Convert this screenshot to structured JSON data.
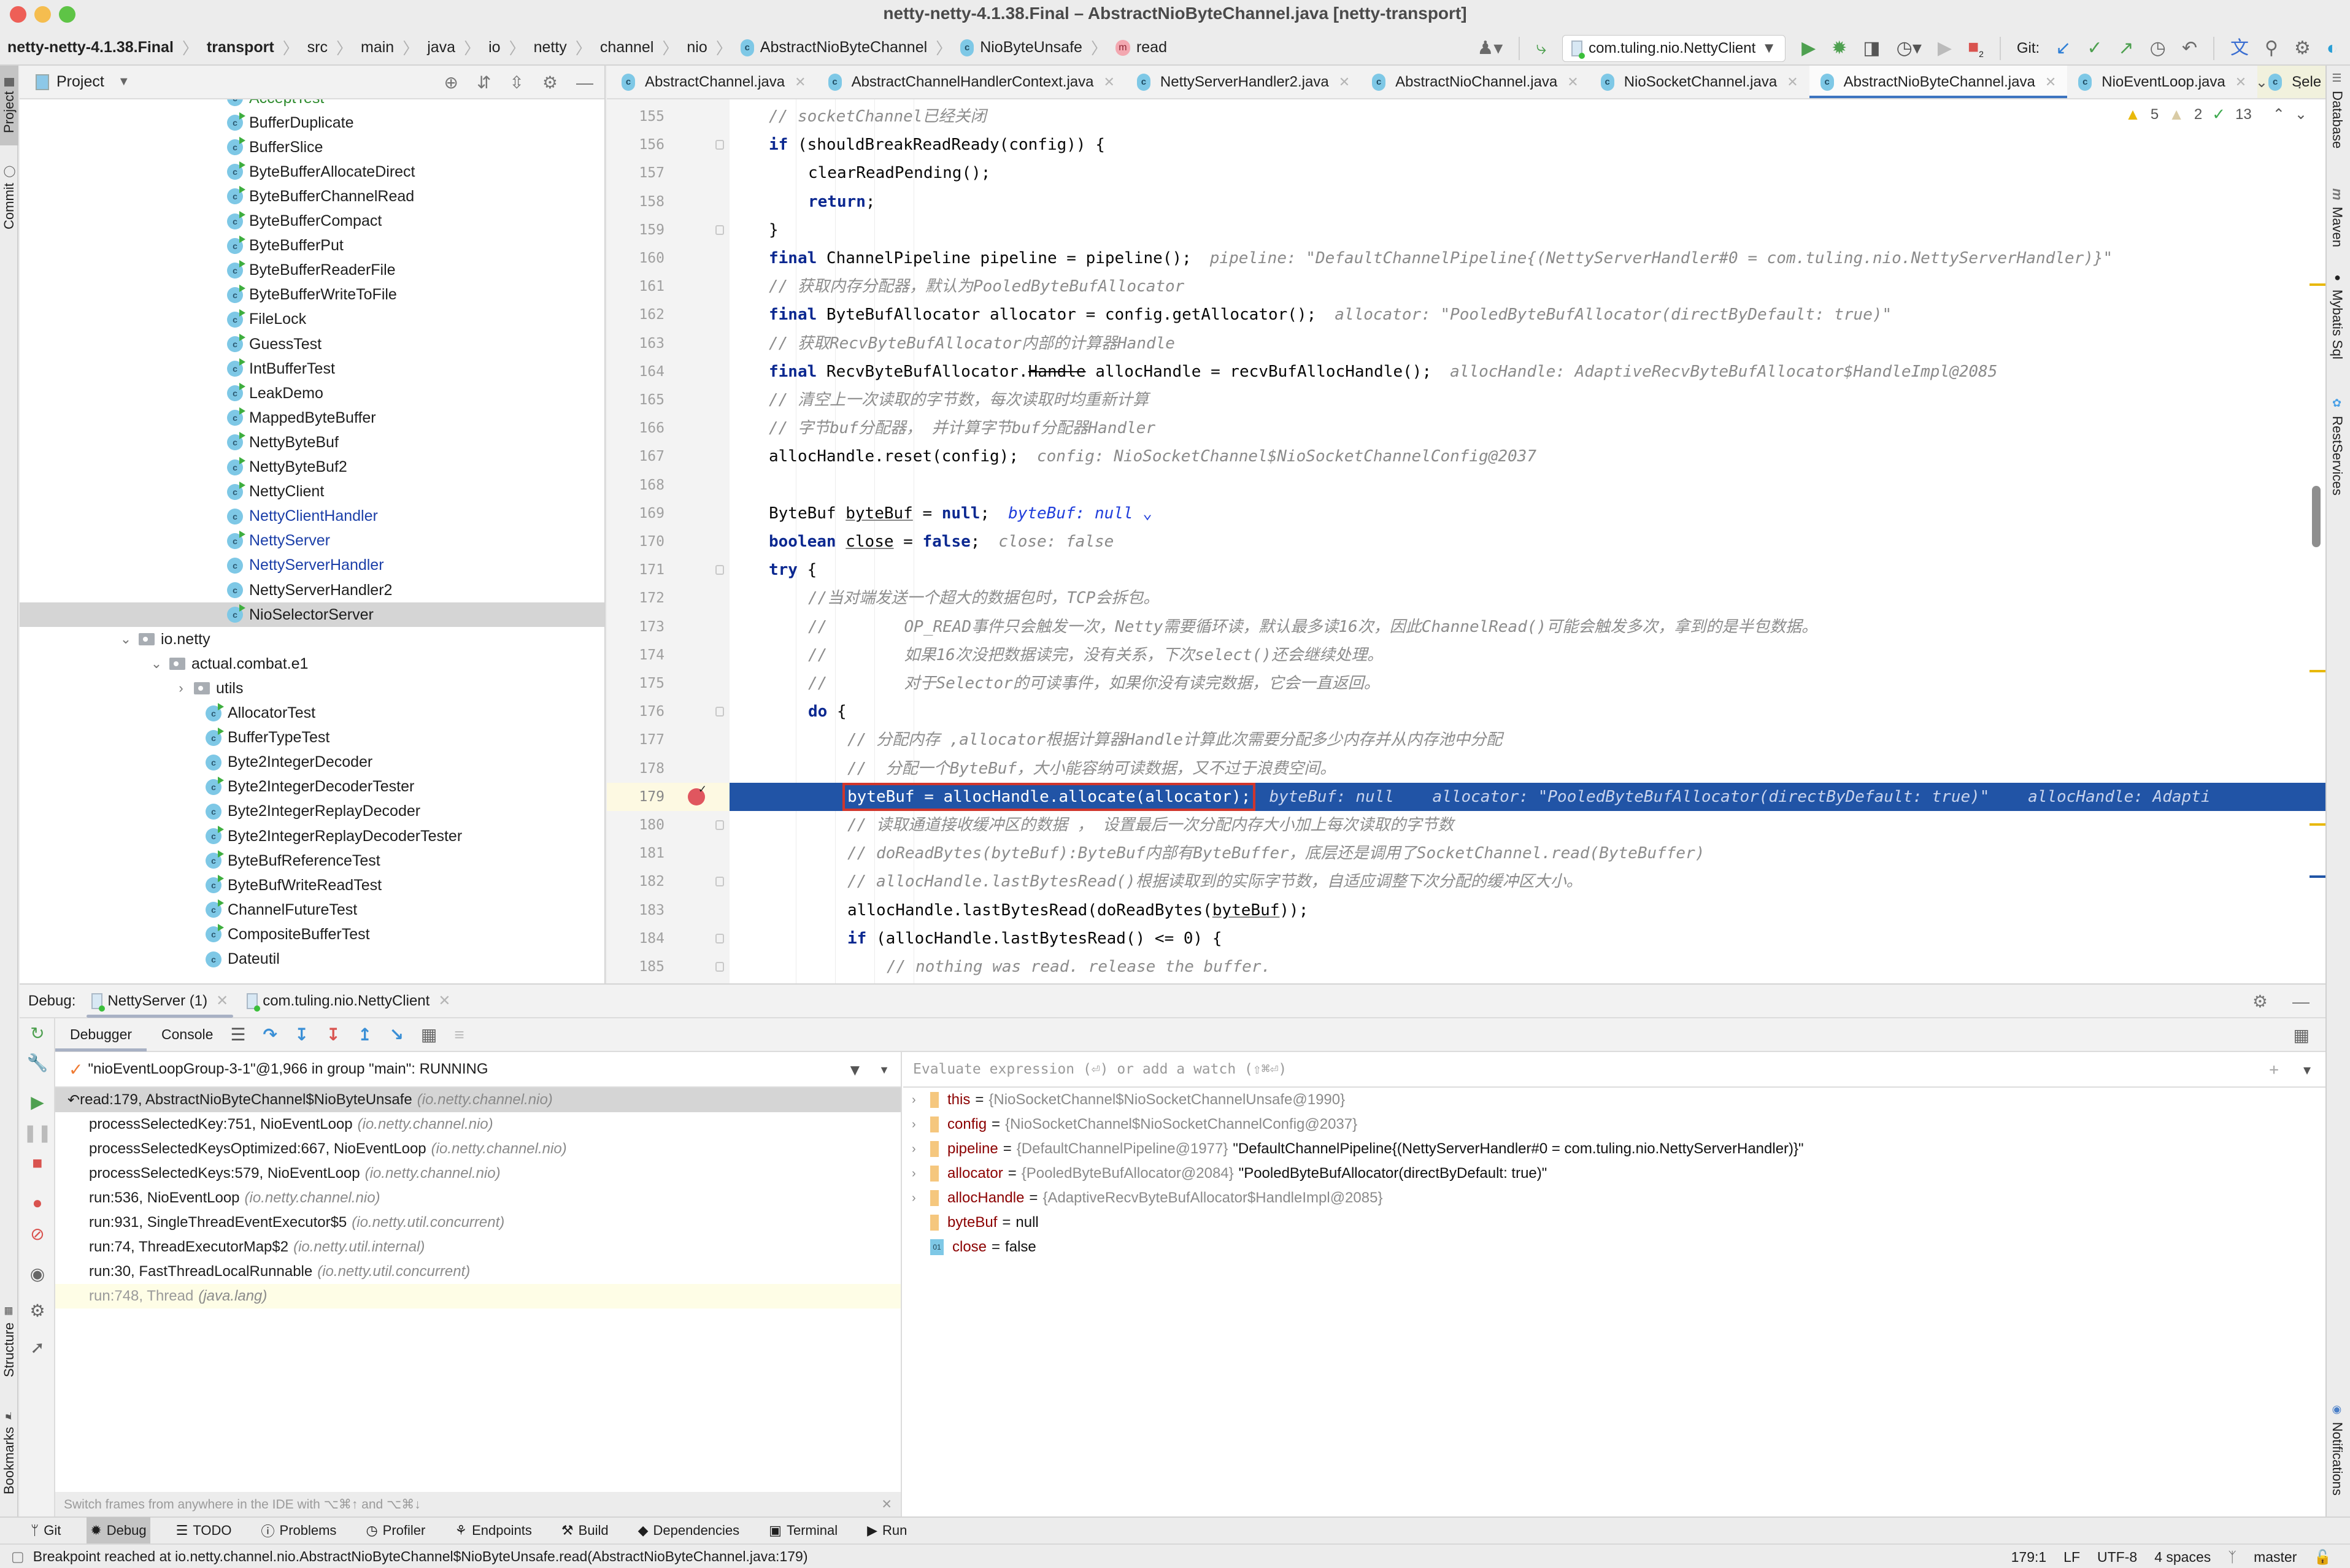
{
  "window": {
    "title": "netty-netty-4.1.38.Final – AbstractNioByteChannel.java [netty-transport]"
  },
  "breadcrumb": [
    {
      "label": "netty-netty-4.1.38.Final",
      "bold": true
    },
    {
      "label": "transport",
      "bold": true
    },
    {
      "label": "src"
    },
    {
      "label": "main"
    },
    {
      "label": "java"
    },
    {
      "label": "io"
    },
    {
      "label": "netty"
    },
    {
      "label": "channel"
    },
    {
      "label": "nio"
    },
    {
      "label": "AbstractNioByteChannel",
      "icon": "class-icon"
    },
    {
      "label": "NioByteUnsafe",
      "icon": "class-icon"
    },
    {
      "label": "read",
      "icon": "method-icon"
    }
  ],
  "toolbar": {
    "run_config": "com.tuling.nio.NettyClient",
    "git_label": "Git:",
    "stop_badge": "2"
  },
  "left_strip": {
    "project": "Project",
    "commit": "Commit",
    "structure": "Structure",
    "bookmarks": "Bookmarks"
  },
  "right_strip": {
    "database": "Database",
    "maven": "Maven",
    "mybatis": "Mybatis Sql",
    "rest": "RestServices",
    "notifications": "Notifications"
  },
  "project": {
    "title": "Project",
    "tree": [
      {
        "label": "AcceptTest",
        "type": "class",
        "run": true,
        "style": "green",
        "level": 2
      },
      {
        "label": "BufferDuplicate",
        "type": "class",
        "run": true,
        "level": 2
      },
      {
        "label": "BufferSlice",
        "type": "class",
        "run": true,
        "level": 2
      },
      {
        "label": "ByteBufferAllocateDirect",
        "type": "class",
        "run": true,
        "level": 2
      },
      {
        "label": "ByteBufferChannelRead",
        "type": "class",
        "run": true,
        "level": 2
      },
      {
        "label": "ByteBufferCompact",
        "type": "class",
        "run": true,
        "level": 2
      },
      {
        "label": "ByteBufferPut",
        "type": "class",
        "run": true,
        "level": 2
      },
      {
        "label": "ByteBufferReaderFile",
        "type": "class",
        "run": true,
        "level": 2
      },
      {
        "label": "ByteBufferWriteToFile",
        "type": "class",
        "run": true,
        "level": 2
      },
      {
        "label": "FileLock",
        "type": "class",
        "run": true,
        "level": 2
      },
      {
        "label": "GuessTest",
        "type": "class",
        "run": true,
        "level": 2
      },
      {
        "label": "IntBufferTest",
        "type": "class",
        "run": true,
        "level": 2
      },
      {
        "label": "LeakDemo",
        "type": "class",
        "run": true,
        "level": 2
      },
      {
        "label": "MappedByteBuffer",
        "type": "class",
        "run": true,
        "level": 2
      },
      {
        "label": "NettyByteBuf",
        "type": "class",
        "run": true,
        "level": 2
      },
      {
        "label": "NettyByteBuf2",
        "type": "class",
        "run": true,
        "level": 2
      },
      {
        "label": "NettyClient",
        "type": "class",
        "run": true,
        "level": 2
      },
      {
        "label": "NettyClientHandler",
        "type": "class",
        "run": false,
        "style": "blue",
        "level": 2
      },
      {
        "label": "NettyServer",
        "type": "class",
        "run": true,
        "style": "blue",
        "level": 2
      },
      {
        "label": "NettyServerHandler",
        "type": "class",
        "run": false,
        "style": "blue",
        "level": 2
      },
      {
        "label": "NettyServerHandler2",
        "type": "class",
        "run": false,
        "level": 2
      },
      {
        "label": "NioSelectorServer",
        "type": "class",
        "run": true,
        "level": 2,
        "selected": true
      },
      {
        "label": "io.netty",
        "type": "package",
        "expanded": true,
        "level": 0
      },
      {
        "label": "actual.combat.e1",
        "type": "package",
        "expanded": true,
        "level": 1
      },
      {
        "label": "utils",
        "type": "package",
        "expanded": false,
        "level": 2
      },
      {
        "label": "AllocatorTest",
        "type": "class",
        "run": true,
        "level": 3
      },
      {
        "label": "BufferTypeTest",
        "type": "class",
        "run": true,
        "level": 3
      },
      {
        "label": "Byte2IntegerDecoder",
        "type": "class",
        "run": false,
        "level": 3
      },
      {
        "label": "Byte2IntegerDecoderTester",
        "type": "class",
        "run": true,
        "level": 3
      },
      {
        "label": "Byte2IntegerReplayDecoder",
        "type": "class",
        "run": false,
        "level": 3
      },
      {
        "label": "Byte2IntegerReplayDecoderTester",
        "type": "class",
        "run": true,
        "level": 3
      },
      {
        "label": "ByteBufReferenceTest",
        "type": "class",
        "run": true,
        "level": 3
      },
      {
        "label": "ByteBufWriteReadTest",
        "type": "class",
        "run": true,
        "level": 3
      },
      {
        "label": "ChannelFutureTest",
        "type": "class",
        "run": true,
        "level": 3
      },
      {
        "label": "CompositeBufferTest",
        "type": "class",
        "run": true,
        "level": 3
      },
      {
        "label": "Dateutil",
        "type": "class",
        "run": false,
        "level": 3
      }
    ]
  },
  "editor": {
    "tabs": [
      {
        "label": "AbstractChannel.java"
      },
      {
        "label": "AbstractChannelHandlerContext.java"
      },
      {
        "label": "NettyServerHandler2.java"
      },
      {
        "label": "AbstractNioChannel.java"
      },
      {
        "label": "NioSocketChannel.java"
      },
      {
        "label": "AbstractNioByteChannel.java",
        "active": true
      },
      {
        "label": "NioEventLoop.java"
      },
      {
        "label": "Sele",
        "pinned": true
      }
    ],
    "inspections": {
      "warnings": "5",
      "weak_warnings": "2",
      "typos": "13"
    },
    "current_line": 179,
    "lines": [
      {
        "n": 155,
        "indent": 2,
        "segs": [
          {
            "t": "// socketChannel已经关闭",
            "c": "cm"
          }
        ]
      },
      {
        "n": 156,
        "indent": 2,
        "fold": true,
        "segs": [
          {
            "t": "if",
            "c": "kw"
          },
          {
            "t": " (shouldBreakReadReady(config)) {"
          }
        ]
      },
      {
        "n": 157,
        "indent": 3,
        "segs": [
          {
            "t": "clearReadPending();"
          }
        ]
      },
      {
        "n": 158,
        "indent": 3,
        "segs": [
          {
            "t": "return",
            "c": "kw"
          },
          {
            "t": ";"
          }
        ]
      },
      {
        "n": 159,
        "indent": 2,
        "fold": true,
        "segs": [
          {
            "t": "}"
          }
        ]
      },
      {
        "n": 160,
        "indent": 2,
        "segs": [
          {
            "t": "final",
            "c": "kw"
          },
          {
            "t": " ChannelPipeline pipeline = pipeline();"
          },
          {
            "t": "pipeline: \"DefaultChannelPipeline{(NettyServerHandler#0 = com.tuling.nio.NettyServerHandler)}\"",
            "c": "hint"
          }
        ]
      },
      {
        "n": 161,
        "indent": 2,
        "segs": [
          {
            "t": "// 获取内存分配器，默认为PooledByteBufAllocator",
            "c": "cm"
          }
        ]
      },
      {
        "n": 162,
        "indent": 2,
        "segs": [
          {
            "t": "final",
            "c": "kw"
          },
          {
            "t": " ByteBufAllocator allocator = config.getAllocator();"
          },
          {
            "t": "allocator: \"PooledByteBufAllocator(directByDefault: true)\"",
            "c": "hint"
          }
        ]
      },
      {
        "n": 163,
        "indent": 2,
        "segs": [
          {
            "t": "// 获取RecvByteBufAllocator内部的计算器Handle",
            "c": "cm"
          }
        ]
      },
      {
        "n": 164,
        "indent": 2,
        "segs": [
          {
            "t": "final",
            "c": "kw"
          },
          {
            "t": " RecvByteBufAllocator."
          },
          {
            "t": "Handle",
            "c": "strike"
          },
          {
            "t": " allocHandle = recvBufAllocHandle();"
          },
          {
            "t": "allocHandle: AdaptiveRecvByteBufAllocator$HandleImpl@2085",
            "c": "hint"
          }
        ]
      },
      {
        "n": 165,
        "indent": 2,
        "segs": [
          {
            "t": "// 清空上一次读取的字节数，每次读取时均重新计算",
            "c": "cm"
          }
        ]
      },
      {
        "n": 166,
        "indent": 2,
        "segs": [
          {
            "t": "// 字节buf分配器， 并计算字节buf分配器Handler",
            "c": "cm"
          }
        ]
      },
      {
        "n": 167,
        "indent": 2,
        "segs": [
          {
            "t": "allocHandle.reset(config);"
          },
          {
            "t": "config: NioSocketChannel$NioSocketChannelConfig@2037",
            "c": "hint"
          }
        ]
      },
      {
        "n": 168,
        "indent": 2,
        "segs": []
      },
      {
        "n": 169,
        "indent": 2,
        "segs": [
          {
            "t": "ByteBuf "
          },
          {
            "t": "byteBuf",
            "c": "uline"
          },
          {
            "t": " = "
          },
          {
            "t": "null",
            "c": "kw"
          },
          {
            "t": ";"
          },
          {
            "t": "byteBuf: null ⌄",
            "c": "hint-blue"
          }
        ]
      },
      {
        "n": 170,
        "indent": 2,
        "segs": [
          {
            "t": "boolean",
            "c": "kw"
          },
          {
            "t": " "
          },
          {
            "t": "close",
            "c": "uline"
          },
          {
            "t": " = "
          },
          {
            "t": "false",
            "c": "kw"
          },
          {
            "t": ";"
          },
          {
            "t": "close: false",
            "c": "hint"
          }
        ]
      },
      {
        "n": 171,
        "indent": 2,
        "fold": true,
        "segs": [
          {
            "t": "try",
            "c": "kw"
          },
          {
            "t": " {"
          }
        ]
      },
      {
        "n": 172,
        "indent": 3,
        "segs": [
          {
            "t": "//当对端发送一个超大的数据包时，TCP会拆包。",
            "c": "cm"
          }
        ]
      },
      {
        "n": 173,
        "indent": 3,
        "segs": [
          {
            "t": "//        OP_READ事件只会触发一次，Netty需要循环读，默认最多读16次，因此ChannelRead()可能会触发多次，拿到的是半包数据。",
            "c": "cm"
          }
        ]
      },
      {
        "n": 174,
        "indent": 3,
        "segs": [
          {
            "t": "//        如果16次没把数据读完，没有关系，下次select()还会继续处理。",
            "c": "cm"
          }
        ]
      },
      {
        "n": 175,
        "indent": 3,
        "segs": [
          {
            "t": "//        对于Selector的可读事件，如果你没有读完数据，它会一直返回。",
            "c": "cm"
          }
        ]
      },
      {
        "n": 176,
        "indent": 3,
        "fold": true,
        "segs": [
          {
            "t": "do",
            "c": "kw"
          },
          {
            "t": " {"
          }
        ]
      },
      {
        "n": 177,
        "indent": 4,
        "segs": [
          {
            "t": "// 分配内存 ,allocator根据计算器Handle计算此次需要分配多少内存并从内存池中分配",
            "c": "cm"
          }
        ]
      },
      {
        "n": 178,
        "indent": 4,
        "segs": [
          {
            "t": "//  分配一个ByteBuf，大小能容纳可读数据，又不过于浪费空间。",
            "c": "cm"
          }
        ]
      },
      {
        "n": 179,
        "indent": 4,
        "highlight": true,
        "breakpoint": true,
        "segs": [
          {
            "t": "byteBuf = allocHandle.allocate(allocator);",
            "c": "redbox"
          },
          {
            "t": "byteBuf: null    allocator: \"PooledByteBufAllocator(directByDefault: true)\"    allocHandle: Adapti",
            "c": "hint"
          }
        ]
      },
      {
        "n": 180,
        "indent": 4,
        "fold": true,
        "segs": [
          {
            "t": "// 读取通道接收缓冲区的数据 ， 设置最后一次分配内存大小加上每次读取的字节数",
            "c": "cm"
          }
        ]
      },
      {
        "n": 181,
        "indent": 4,
        "segs": [
          {
            "t": "// doReadBytes(byteBuf):ByteBuf内部有ByteBuffer，底层还是调用了SocketChannel.read(ByteBuffer)",
            "c": "cm"
          }
        ]
      },
      {
        "n": 182,
        "indent": 4,
        "fold": true,
        "segs": [
          {
            "t": "// allocHandle.lastBytesRead()根据读取到的实际字节数，自适应调整下次分配的缓冲区大小。",
            "c": "cm"
          }
        ]
      },
      {
        "n": 183,
        "indent": 4,
        "segs": [
          {
            "t": "allocHandle.lastBytesRead(doReadBytes("
          },
          {
            "t": "byteBuf",
            "c": "uline"
          },
          {
            "t": "));"
          }
        ]
      },
      {
        "n": 184,
        "indent": 4,
        "fold": true,
        "segs": [
          {
            "t": "if",
            "c": "kw"
          },
          {
            "t": " (allocHandle.lastBytesRead() <= 0) {"
          }
        ]
      },
      {
        "n": 185,
        "indent": 5,
        "fold": true,
        "segs": [
          {
            "t": "// nothing was read. release the buffer.",
            "c": "cm"
          }
        ]
      }
    ]
  },
  "debug": {
    "label": "Debug:",
    "sessions": [
      {
        "label": "NettyServer (1)",
        "active": true
      },
      {
        "label": "com.tuling.nio.NettyClient"
      }
    ],
    "tabs": [
      {
        "label": "Debugger",
        "active": true
      },
      {
        "label": "Console"
      }
    ],
    "thread": "\"nioEventLoopGroup-3-1\"@1,966 in group \"main\": RUNNING",
    "frames": [
      {
        "method": "read:179, AbstractNioByteChannel$NioByteUnsafe",
        "pkg": "(io.netty.channel.nio)",
        "selected": true
      },
      {
        "method": "processSelectedKey:751, NioEventLoop",
        "pkg": "(io.netty.channel.nio)"
      },
      {
        "method": "processSelectedKeysOptimized:667, NioEventLoop",
        "pkg": "(io.netty.channel.nio)"
      },
      {
        "method": "processSelectedKeys:579, NioEventLoop",
        "pkg": "(io.netty.channel.nio)"
      },
      {
        "method": "run:536, NioEventLoop",
        "pkg": "(io.netty.channel.nio)"
      },
      {
        "method": "run:931, SingleThreadEventExecutor$5",
        "pkg": "(io.netty.util.concurrent)"
      },
      {
        "method": "run:74, ThreadExecutorMap$2",
        "pkg": "(io.netty.util.internal)"
      },
      {
        "method": "run:30, FastThreadLocalRunnable",
        "pkg": "(io.netty.util.concurrent)"
      },
      {
        "method": "run:748, Thread",
        "pkg": "(java.lang)",
        "library": true
      }
    ],
    "frames_hint": "Switch frames from anywhere in the IDE with ⌥⌘↑ and ⌥⌘↓",
    "watch_placeholder": "Evaluate expression (⏎) or add a watch (⇧⌘⏎)",
    "variables": [
      {
        "name": "this",
        "type": "{NioSocketChannel$NioSocketChannelUnsafe@1990}",
        "value": "",
        "expandable": true
      },
      {
        "name": "config",
        "type": "{NioSocketChannel$NioSocketChannelConfig@2037}",
        "value": "",
        "expandable": true
      },
      {
        "name": "pipeline",
        "type": "{DefaultChannelPipeline@1977}",
        "value": "\"DefaultChannelPipeline{(NettyServerHandler#0 = com.tuling.nio.NettyServerHandler)}\"",
        "expandable": true
      },
      {
        "name": "allocator",
        "type": "{PooledByteBufAllocator@2084}",
        "value": "\"PooledByteBufAllocator(directByDefault: true)\"",
        "expandable": true
      },
      {
        "name": "allocHandle",
        "type": "{AdaptiveRecvByteBufAllocator$HandleImpl@2085}",
        "value": "",
        "expandable": true
      },
      {
        "name": "byteBuf",
        "type": "",
        "value": "null",
        "expandable": false
      },
      {
        "name": "close",
        "type": "",
        "value": "false",
        "expandable": false,
        "primitive": true
      }
    ]
  },
  "bottom_tools": [
    {
      "label": "Git",
      "icon": "git-branch-icon"
    },
    {
      "label": "Debug",
      "icon": "bug-icon",
      "active": true
    },
    {
      "label": "TODO",
      "icon": "list-icon"
    },
    {
      "label": "Problems",
      "icon": "problems-icon"
    },
    {
      "label": "Profiler",
      "icon": "profiler-icon"
    },
    {
      "label": "Endpoints",
      "icon": "endpoints-icon"
    },
    {
      "label": "Build",
      "icon": "hammer-icon"
    },
    {
      "label": "Dependencies",
      "icon": "dependencies-icon"
    },
    {
      "label": "Terminal",
      "icon": "terminal-icon"
    },
    {
      "label": "Run",
      "icon": "run-icon"
    }
  ],
  "status": {
    "message": "Breakpoint reached at io.netty.channel.nio.AbstractNioByteChannel$NioByteUnsafe.read(AbstractNioByteChannel.java:179)",
    "position": "179:1",
    "line_sep": "LF",
    "encoding": "UTF-8",
    "indent": "4 spaces",
    "branch": "master"
  },
  "colors": {
    "highlight_line": "#2154a6",
    "breakpoint": "#e0565f",
    "red_box": "#d0362c",
    "keyword": "#0b2890"
  }
}
